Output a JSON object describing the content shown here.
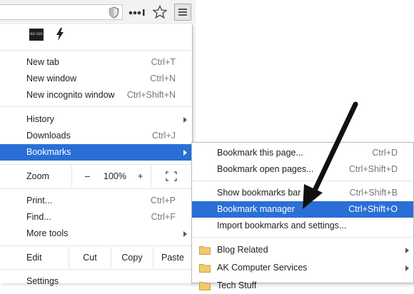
{
  "toolbar": {
    "shield_icon": "shield-icon",
    "more_icon": "dots-icon",
    "star_icon": "star-icon",
    "menu_icon": "hamburger-icon"
  },
  "extensions": {
    "noads_label": "NO ADS",
    "bolt_icon": "lightning-icon"
  },
  "menu": {
    "new_tab": {
      "label": "New tab",
      "shortcut": "Ctrl+T"
    },
    "new_window": {
      "label": "New window",
      "shortcut": "Ctrl+N"
    },
    "new_incognito": {
      "label": "New incognito window",
      "shortcut": "Ctrl+Shift+N"
    },
    "history": {
      "label": "History"
    },
    "downloads": {
      "label": "Downloads",
      "shortcut": "Ctrl+J"
    },
    "bookmarks": {
      "label": "Bookmarks"
    },
    "zoom": {
      "label": "Zoom",
      "minus": "–",
      "value": "100%",
      "plus": "+"
    },
    "print": {
      "label": "Print...",
      "shortcut": "Ctrl+P"
    },
    "find": {
      "label": "Find...",
      "shortcut": "Ctrl+F"
    },
    "more_tools": {
      "label": "More tools"
    },
    "edit": {
      "label": "Edit",
      "cut": "Cut",
      "copy": "Copy",
      "paste": "Paste"
    },
    "settings": {
      "label": "Settings"
    }
  },
  "bookmarks_submenu": {
    "bookmark_page": {
      "label": "Bookmark this page...",
      "shortcut": "Ctrl+D"
    },
    "bookmark_open": {
      "label": "Bookmark open pages...",
      "shortcut": "Ctrl+Shift+D"
    },
    "show_bar": {
      "label": "Show bookmarks bar",
      "shortcut": "Ctrl+Shift+B"
    },
    "manager": {
      "label": "Bookmark manager",
      "shortcut": "Ctrl+Shift+O"
    },
    "import": {
      "label": "Import bookmarks and settings..."
    },
    "folders": [
      {
        "label": "Blog Related"
      },
      {
        "label": "AK Computer Services"
      },
      {
        "label": "Tech Stuff"
      }
    ]
  },
  "colors": {
    "highlight": "#2a6fd6",
    "annotation_arrow": "#111111"
  }
}
